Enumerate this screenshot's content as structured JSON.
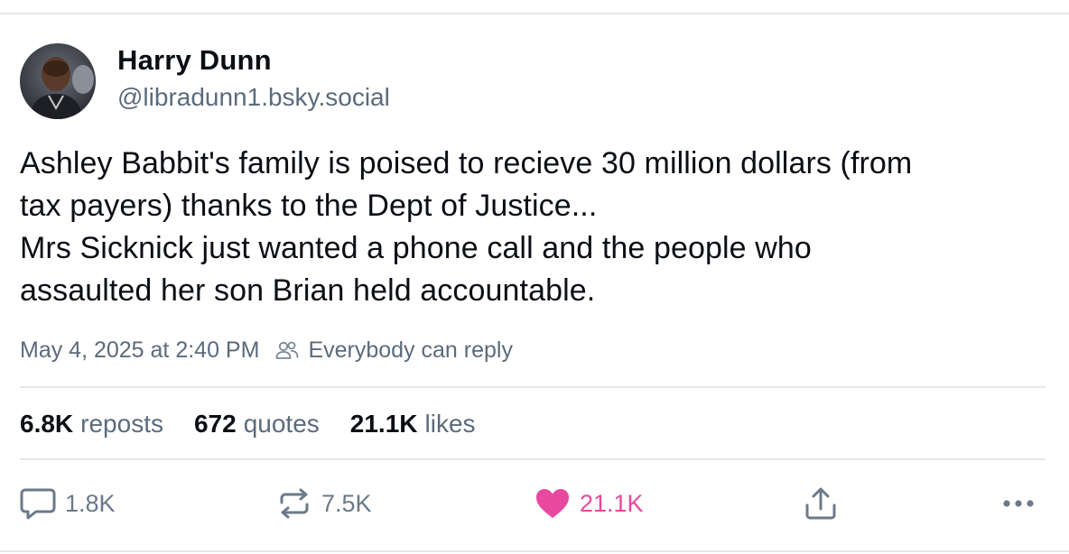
{
  "author": {
    "display_name": "Harry Dunn",
    "handle": "@libradunn1.bsky.social",
    "avatar_icon": "profile-photo"
  },
  "post": {
    "lines": [
      "Ashley Babbit's family is poised to recieve 30 million dollars (from",
      "tax payers) thanks to the Dept of Justice...",
      "Mrs Sicknick just wanted a phone call and the people who",
      "assaulted her son Brian held accountable."
    ],
    "timestamp": "May 4, 2025 at 2:40 PM",
    "reply_setting": "Everybody can reply"
  },
  "stats": {
    "reposts_count": "6.8K",
    "reposts_label": "reposts",
    "quotes_count": "672",
    "quotes_label": "quotes",
    "likes_count": "21.1K",
    "likes_label": "likes"
  },
  "actions": {
    "reply_count": "1.8K",
    "repost_count": "7.5K",
    "like_count": "21.1K",
    "reply_icon": "speech-bubble-icon",
    "repost_icon": "repost-arrows-icon",
    "like_icon": "heart-icon",
    "share_icon": "share-icon",
    "more_icon": "ellipsis-icon"
  },
  "colors": {
    "text_primary": "#0b0f14",
    "text_secondary": "#5b6b7c",
    "like_active": "#e8489e",
    "divider": "#e3e7ec"
  }
}
